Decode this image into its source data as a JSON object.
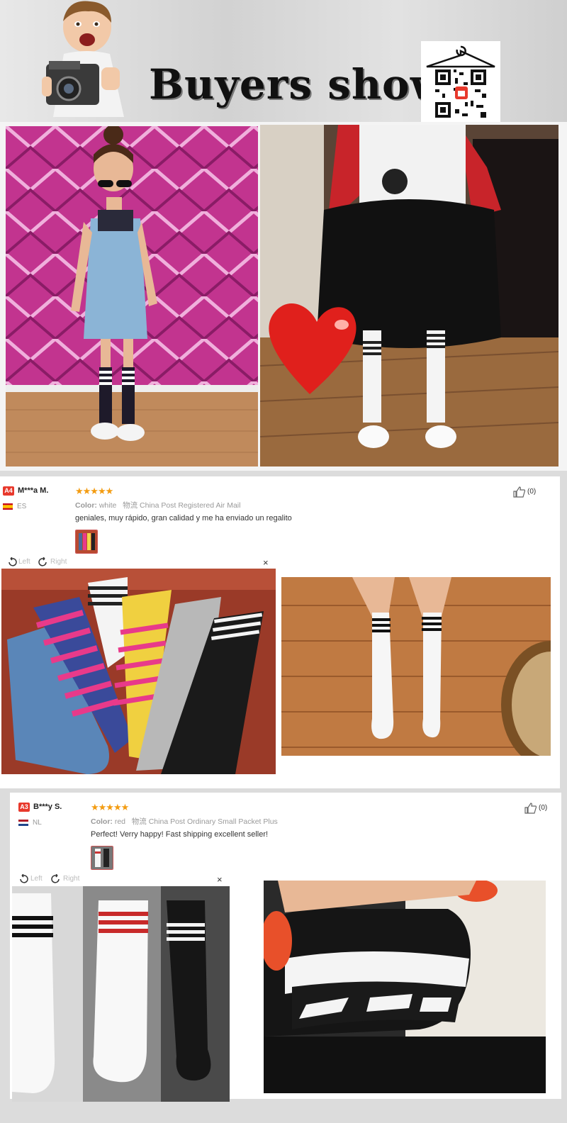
{
  "header": {
    "title": "Buyers show",
    "qr_icon": "qr-code-icon",
    "boy_icon": "boy-with-camera-image"
  },
  "reviews": [
    {
      "badge": "A4",
      "username": "M***a M.",
      "country": "ES",
      "rating": 5,
      "stars": "★★★★★",
      "color_label": "Color:",
      "color_value": "white",
      "logistics_label": "物流",
      "logistics_value": "China Post Registered Air Mail",
      "text": "geniales, muy rápido, gran calidad y me ha enviado un regalito",
      "likes": "(0)",
      "left_label": "Left",
      "right_label": "Right",
      "close": "×"
    },
    {
      "badge": "A3",
      "username": "B***y S.",
      "country": "NL",
      "rating": 5,
      "stars": "★★★★★",
      "color_label": "Color:",
      "color_value": "red",
      "logistics_label": "物流",
      "logistics_value": "China Post Ordinary Small Packet Plus",
      "text": "Perfect! Verry happy! Fast shipping excellent seller!",
      "likes": "(0)",
      "left_label": "Left",
      "right_label": "Right",
      "close": "×"
    }
  ],
  "colors": {
    "star": "#f39c12",
    "badge": "#e8392c",
    "muted": "#999999"
  }
}
